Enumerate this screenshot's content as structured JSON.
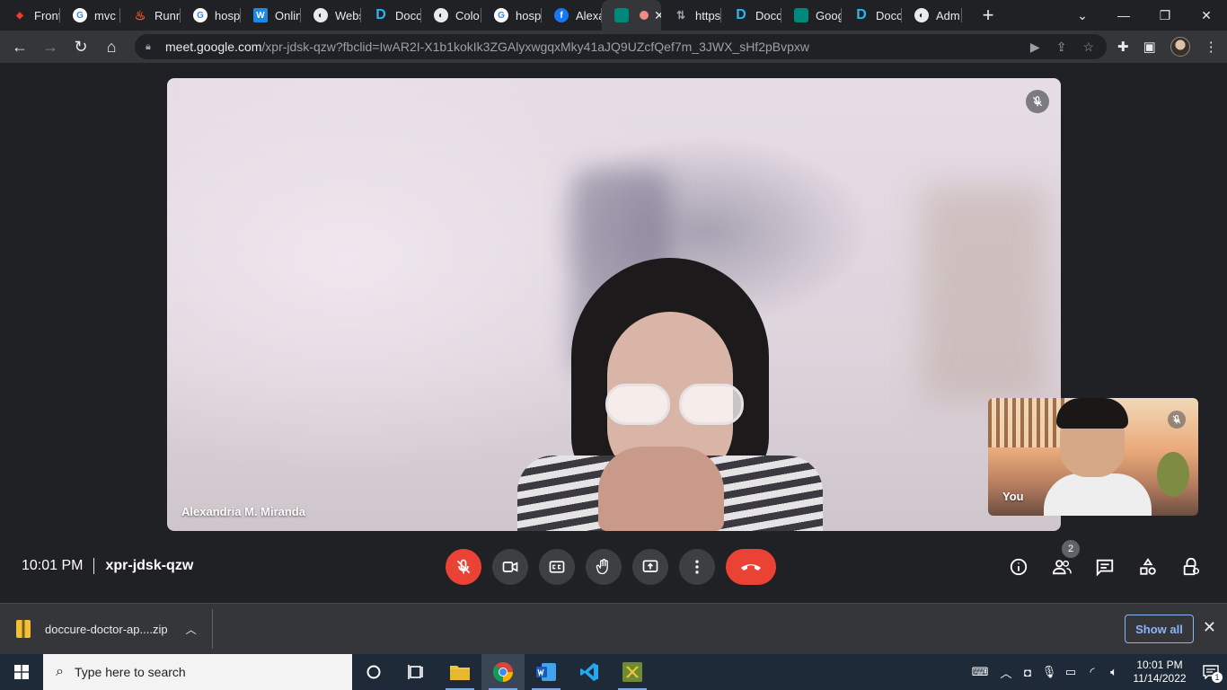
{
  "browser": {
    "tabs": [
      {
        "title": "Front",
        "icon": "laravel-icon",
        "color": "#ef3b2d"
      },
      {
        "title": "mvc l",
        "icon": "google-icon",
        "color": "#4285f4"
      },
      {
        "title": "Runn",
        "icon": "fire-icon",
        "color": "#f4511e"
      },
      {
        "title": "hosp",
        "icon": "google-icon",
        "color": "#4285f4"
      },
      {
        "title": "Onlin",
        "icon": "w-icon",
        "color": "#1e88e5"
      },
      {
        "title": "Webs",
        "icon": "globe-icon",
        "color": "#9aa0a6"
      },
      {
        "title": "Docc",
        "icon": "d-icon",
        "color": "#29b6f6"
      },
      {
        "title": "Colo",
        "icon": "globe-icon",
        "color": "#9aa0a6"
      },
      {
        "title": "hosp",
        "icon": "google-icon",
        "color": "#4285f4"
      },
      {
        "title": "Alexa",
        "icon": "facebook-icon",
        "color": "#1877f2"
      }
    ],
    "active_tab": {
      "icon": "meet-icon",
      "recording": true,
      "close": "✕"
    },
    "tabs_after": [
      {
        "title": "https",
        "icon": "arrows-icon",
        "color": "#9aa0a6"
      },
      {
        "title": "Docc",
        "icon": "d-icon",
        "color": "#29b6f6"
      },
      {
        "title": "Goog",
        "icon": "meet-icon",
        "color": "#00897b"
      },
      {
        "title": "Docc",
        "icon": "d-icon",
        "color": "#29b6f6"
      },
      {
        "title": "Adm",
        "icon": "globe-icon",
        "color": "#9aa0a6"
      }
    ],
    "new_tab": "+",
    "url_host": "meet.google.com",
    "url_path": "/xpr-jdsk-qzw?fbclid=IwAR2I-X1b1kokIk3ZGAlyxwgqxMky41aJQ9UZcfQef7m_3JWX_sHf2pBvpxw"
  },
  "meeting": {
    "main_participant": "Alexandria M. Miranda",
    "self_label": "You",
    "time": "10:01 PM",
    "code": "xpr-jdsk-qzw",
    "participants_count": "2"
  },
  "downloads": {
    "file": "doccure-doctor-ap....zip",
    "show_all": "Show all",
    "close": "✕"
  },
  "taskbar": {
    "search_placeholder": "Type here to search",
    "time": "10:01 PM",
    "date": "11/14/2022",
    "notifications": "1"
  }
}
